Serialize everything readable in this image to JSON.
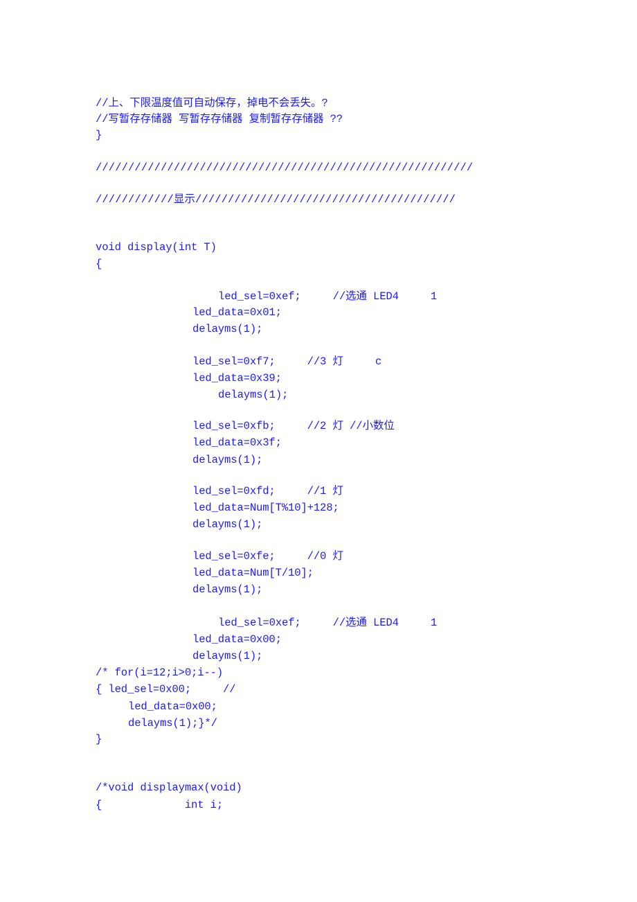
{
  "document": {
    "text_color": "#1a1aff",
    "lines": [
      "//上、下限温度值可自动保存，掉电不会丢失。?",
      "//写暂存存储器 写暂存存储器 复制暂存存储器 ??",
      "}",
      "//////////////////////////////////////////////////////////",
      "////////////显示////////////////////////////////////////",
      "void display(int T)",
      "{",
      "led_sel=0xef;     //选通 LED4     1",
      "led_data=0x01;",
      "delayms(1);",
      "led_sel=0xf7;     //3 灯     c",
      "led_data=0x39;",
      "delayms(1);",
      "led_sel=0xfb;     //2 灯 //小数位",
      "led_data=0x3f;",
      "delayms(1);",
      "led_sel=0xfd;     //1 灯",
      "led_data=Num[T%10]+128;",
      "delayms(1);",
      "led_sel=0xfe;     //0 灯",
      "led_data=Num[T/10];",
      "delayms(1);",
      "led_sel=0xef;     //选通 LED4     1",
      "led_data=0x00;",
      "delayms(1);",
      "/* for(i=12;i>0;i--)",
      "{ led_sel=0x00;     //",
      "led_data=0x00;",
      "delayms(1);}*/",
      "}",
      "/*void displaymax(void)",
      "{             int i;"
    ]
  }
}
